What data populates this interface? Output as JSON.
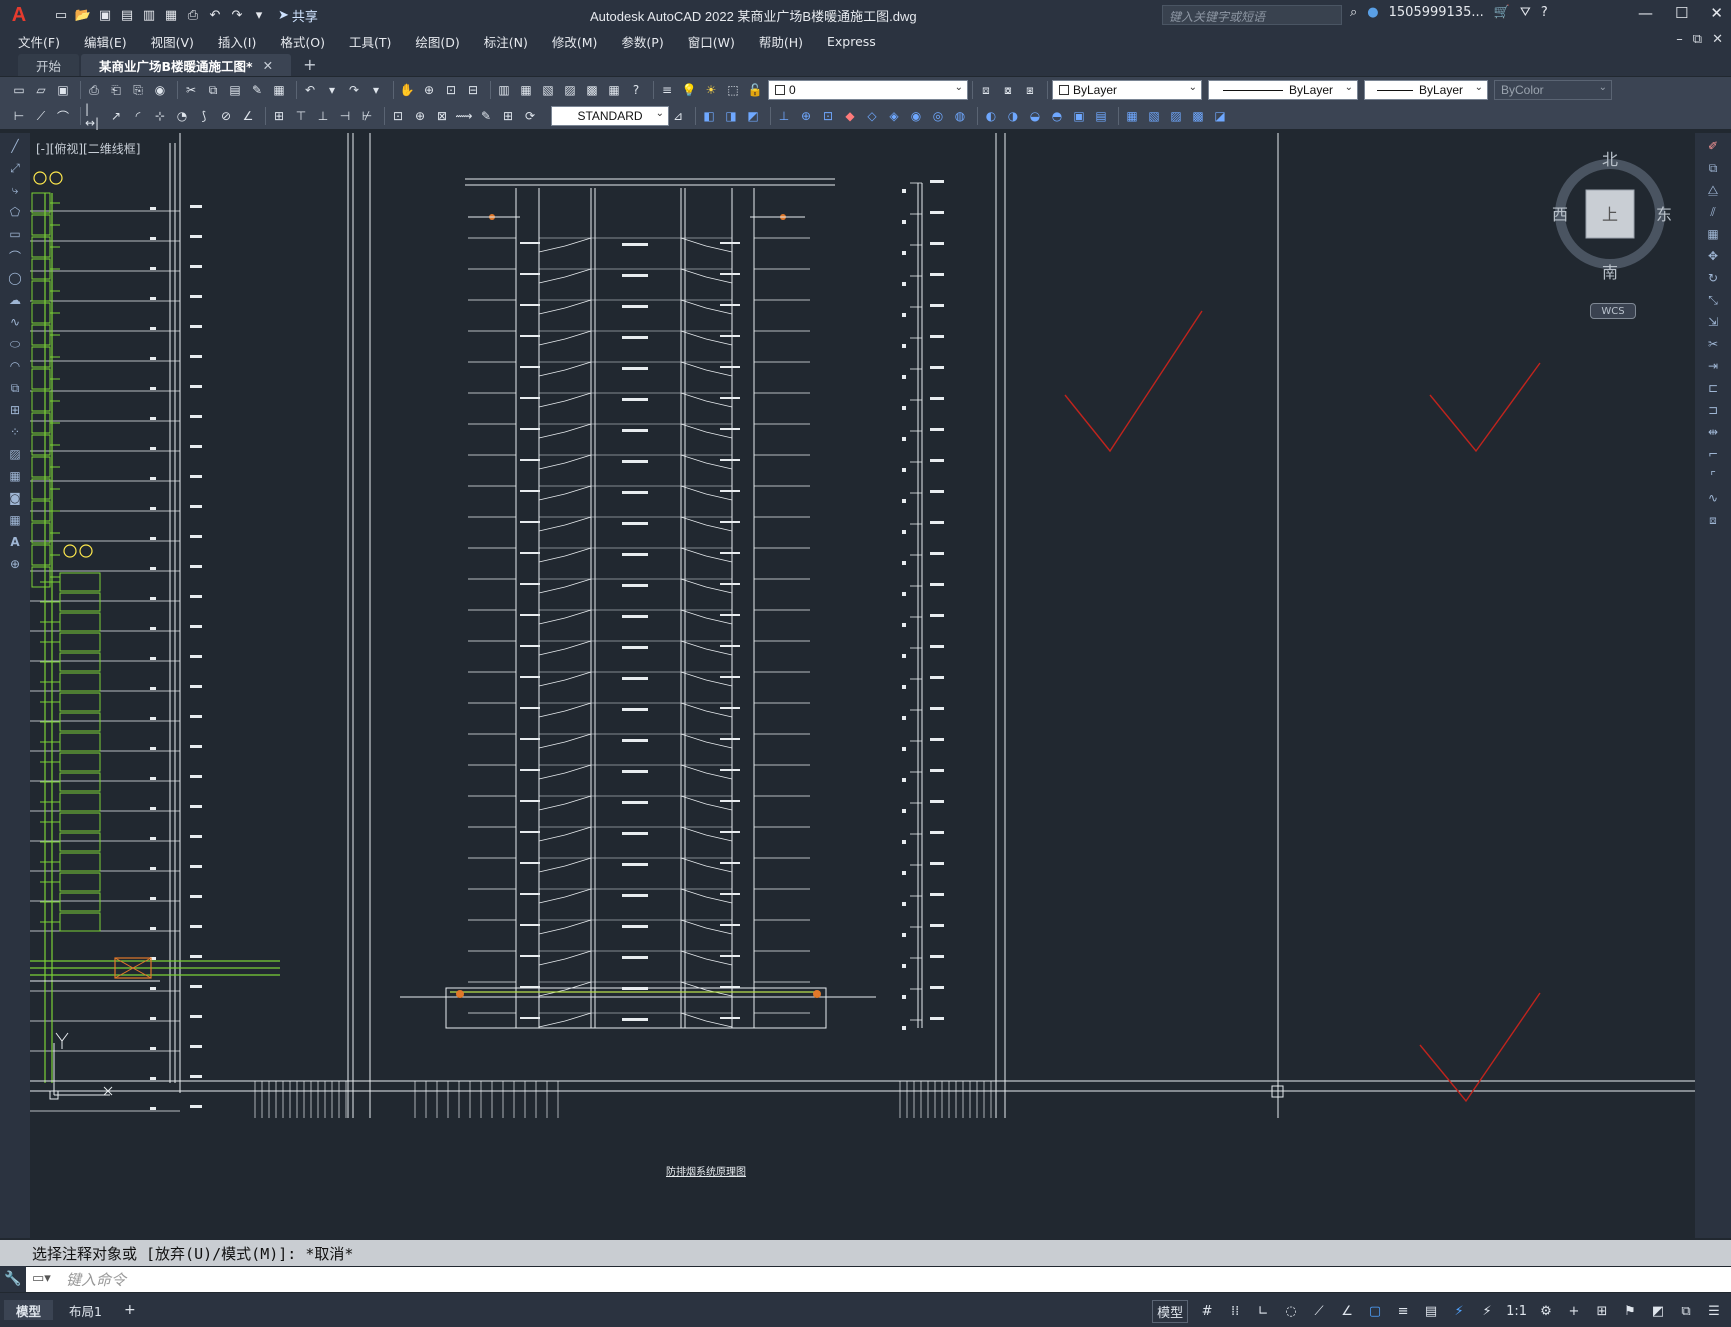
{
  "app": {
    "logo": "A",
    "title": "Autodesk AutoCAD 2022    某商业广场B楼暖通施工图.dwg",
    "share_label": "共享",
    "search_placeholder": "键入关键字或短语",
    "user": "1505999135...",
    "window_controls": [
      "—",
      "☐",
      "✕"
    ]
  },
  "menu": [
    "文件(F)",
    "编辑(E)",
    "视图(V)",
    "插入(I)",
    "格式(O)",
    "工具(T)",
    "绘图(D)",
    "标注(N)",
    "修改(M)",
    "参数(P)",
    "窗口(W)",
    "帮助(H)",
    "Express"
  ],
  "filetabs": [
    {
      "label": "开始",
      "active": false
    },
    {
      "label": "某商业广场B楼暖通施工图*",
      "active": true
    }
  ],
  "toolbar": {
    "layer_value": "0",
    "color_value": "ByLayer",
    "linetype_value": "ByLayer",
    "lineweight_value": "ByLayer",
    "plotstyle_value": "ByColor",
    "textstyle_value": "STANDARD"
  },
  "viewport": {
    "label": "[-][俯视][二维线框]",
    "compass": {
      "north": "北",
      "south": "南",
      "east": "东",
      "west": "西",
      "top": "上"
    },
    "wcs": "WCS"
  },
  "drawing": {
    "title": "防排烟系统原理图"
  },
  "command": {
    "history": "选择注释对象或 [放弃(U)/模式(M)]: *取消*",
    "placeholder": "键入命令"
  },
  "status": {
    "tabs": [
      {
        "label": "模型",
        "active": true
      },
      {
        "label": "布局1",
        "active": false
      }
    ],
    "model_label": "模型",
    "scale": "1:1"
  },
  "colors": {
    "background": "#212830",
    "chrome": "#2b3340",
    "toolbar": "#3b4453",
    "drawing_lines": "#e8ecef",
    "drawing_green": "#7bd236",
    "drawing_red": "#c0241d",
    "drawing_orange": "#e0782a"
  }
}
